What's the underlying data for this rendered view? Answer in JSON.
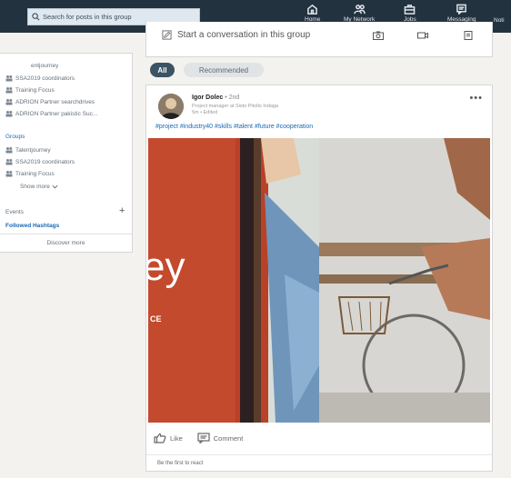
{
  "search": {
    "placeholder": "Search for posts in this group"
  },
  "nav": [
    {
      "label": "Home",
      "icon": "home-icon"
    },
    {
      "label": "My Network",
      "icon": "people-icon"
    },
    {
      "label": "Jobs",
      "icon": "briefcase-icon"
    },
    {
      "label": "Messaging",
      "icon": "messaging-icon"
    },
    {
      "label": "Noti"
    }
  ],
  "sidebar": {
    "header_partial": "entjourney",
    "top_items": [
      "SSA2019 coordinators",
      "Training Focus",
      "ADRION Partner searchdrives",
      "ADRION Partner pakistic Suc..."
    ],
    "groups_label": "Groups",
    "group_items": [
      "Talentjourney",
      "SSA2019 coordinators",
      "Training Focus"
    ],
    "show_more": "Show more",
    "events_label": "Events",
    "events_add": "+",
    "followed_hashtags": "Followed Hashtags",
    "discover_more": "Discover more"
  },
  "compose": {
    "prompt": "Start a conversation in this group"
  },
  "tabs": {
    "all": "All",
    "recommended": "Recommended"
  },
  "post": {
    "author": "Igor Dolec",
    "degree": "• 2nd",
    "headline": "Project manager at Sisto Pitollo Indaga",
    "meta": "5m • Edited",
    "hashtags": "#project #industry40 #skills #talent #future #cooperation",
    "image_text_large": "ey",
    "image_text_small": "CE",
    "like": "Like",
    "comment": "Comment",
    "reaction_prompt": "Be the first to react"
  },
  "colors": {
    "topbar": "#23323f",
    "accent": "#1a68b6",
    "tab_active": "#3c5363"
  }
}
